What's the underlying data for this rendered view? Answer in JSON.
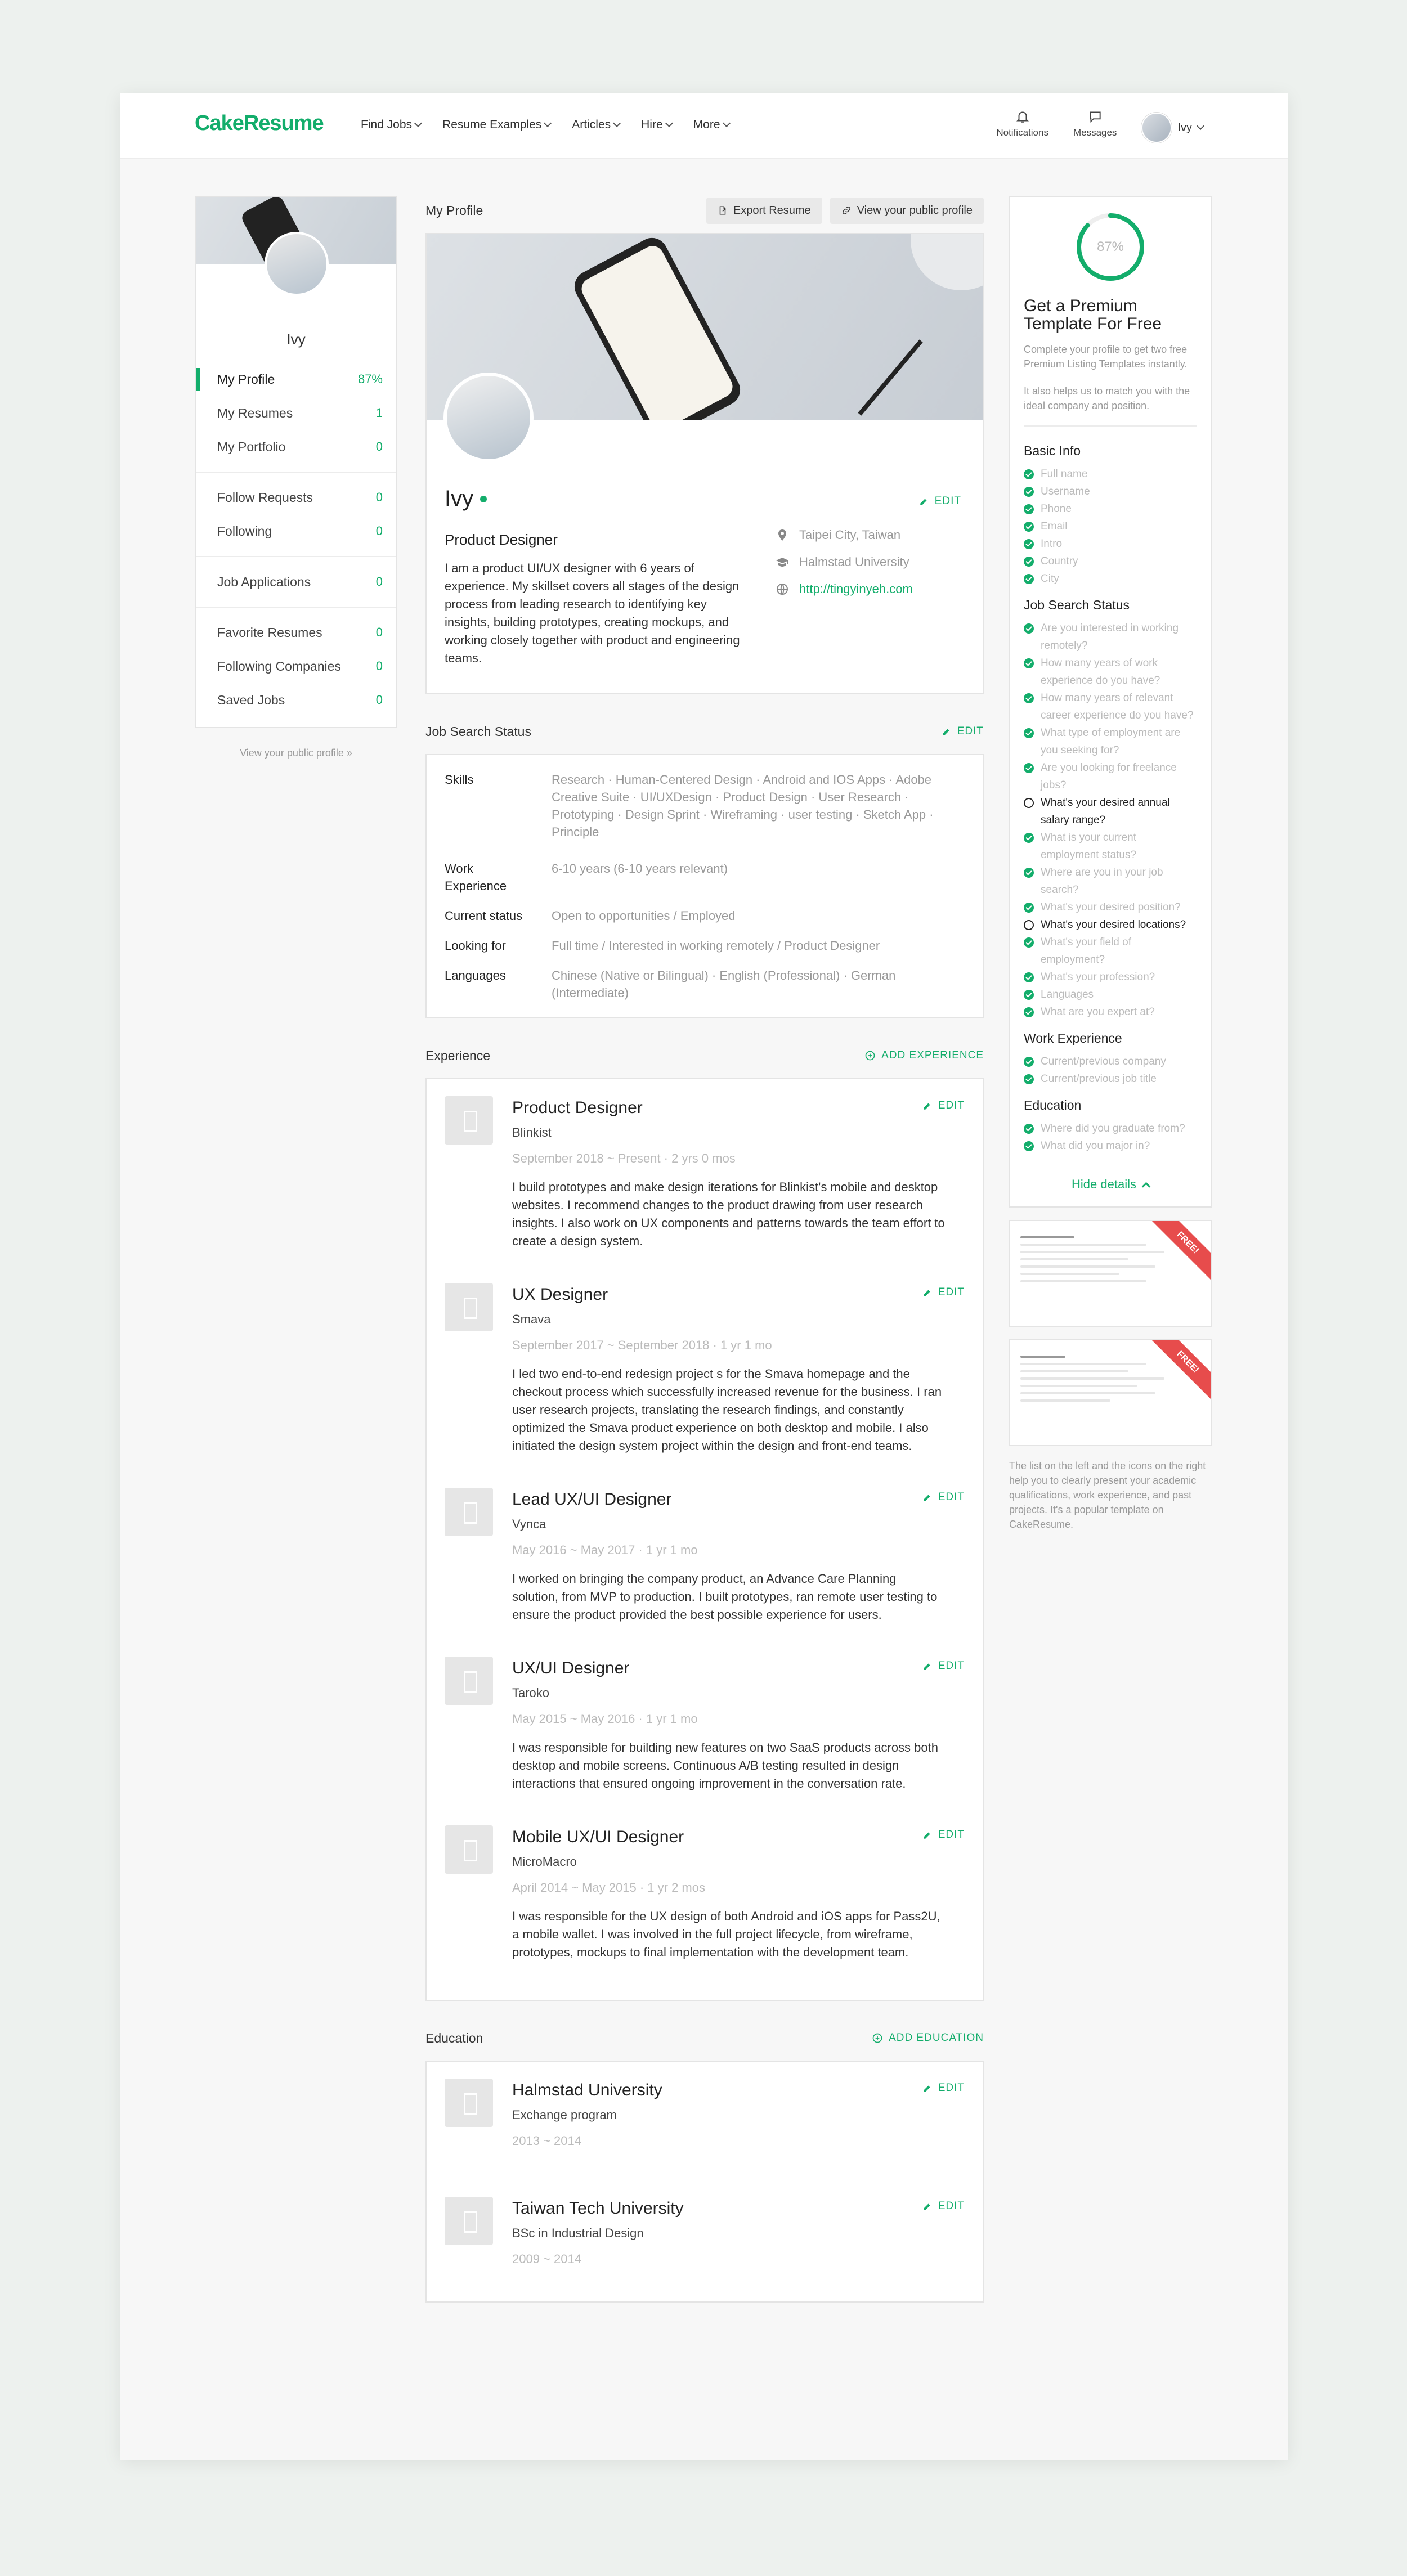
{
  "nav": {
    "logo": "CakeResume",
    "menu": [
      "Find Jobs",
      "Resume Examples",
      "Articles",
      "Hire",
      "More"
    ],
    "notifications": "Notifications",
    "messages": "Messages",
    "user": "Ivy"
  },
  "sidebar": {
    "name": "Ivy",
    "groups": [
      [
        {
          "label": "My Profile",
          "value": "87%"
        },
        {
          "label": "My Resumes",
          "value": "1"
        },
        {
          "label": "My Portfolio",
          "value": "0"
        }
      ],
      [
        {
          "label": "Follow Requests",
          "value": "0"
        },
        {
          "label": "Following",
          "value": "0"
        }
      ],
      [
        {
          "label": "Job Applications",
          "value": "0"
        }
      ],
      [
        {
          "label": "Favorite Resumes",
          "value": "0"
        },
        {
          "label": "Following Companies",
          "value": "0"
        },
        {
          "label": "Saved Jobs",
          "value": "0"
        }
      ]
    ],
    "footer_link": "View your public profile »"
  },
  "profile": {
    "section_title": "My Profile",
    "export_label": "Export Resume",
    "view_label": "View your public profile",
    "name": "Ivy",
    "edit_label": "EDIT",
    "role": "Product Designer",
    "bio": "I am a product UI/UX designer with 6 years of experience. My skillset covers all stages of the design process from leading research to identifying key insights, building prototypes, creating mockups, and working closely together with product and engineering teams.",
    "location": "Taipei City, Taiwan",
    "school": "Halmstad University",
    "website": "http://tingyinyeh.com"
  },
  "job_search": {
    "title": "Job Search Status",
    "rows": [
      {
        "label": "Skills",
        "value": "Research · Human-Centered Design · Android and IOS Apps · Adobe Creative Suite · UI/UXDesign · Product Design · User Research · Prototyping · Design Sprint · Wireframing · user testing · Sketch App · Principle"
      },
      {
        "label": "Work Experience",
        "value": "6-10 years (6-10 years relevant)"
      },
      {
        "label": "Current status",
        "value": "Open to opportunities / Employed"
      },
      {
        "label": "Looking for",
        "value": "Full time / Interested in working remotely / Product Designer"
      },
      {
        "label": "Languages",
        "value": "Chinese (Native or Bilingual) · English (Professional) · German (Intermediate)"
      }
    ]
  },
  "experience": {
    "title": "Experience",
    "add_label": "ADD EXPERIENCE",
    "items": [
      {
        "title": "Product Designer",
        "company": "Blinkist",
        "date": "September 2018 ~ Present · 2 yrs 0 mos",
        "desc": "I build prototypes and make design iterations for Blinkist's mobile and desktop websites. I recommend changes to the product drawing from user research insights. I also work on UX components and patterns towards the team effort to create a design system."
      },
      {
        "title": "UX Designer",
        "company": "Smava",
        "date": "September 2017 ~ September 2018 · 1 yr 1 mo",
        "desc": "I led two end-to-end redesign project s for the Smava homepage and the checkout process which successfully increased revenue for the business. I ran user research projects, translating the research findings, and constantly optimized the Smava product experience on both desktop and mobile. I also initiated the design system project within the design and front-end teams."
      },
      {
        "title": "Lead UX/UI Designer",
        "company": "Vynca",
        "date": "May 2016 ~ May 2017 · 1 yr 1 mo",
        "desc": "I worked on bringing the company product, an Advance Care Planning solution, from MVP to production. I built prototypes, ran remote user testing to ensure the product provided the best possible experience for users."
      },
      {
        "title": "UX/UI Designer",
        "company": "Taroko",
        "date": "May 2015 ~ May 2016 · 1 yr 1 mo",
        "desc": "I was responsible for building new features on two SaaS products across both desktop and mobile screens. Continuous A/B testing resulted in design interactions that ensured ongoing improvement in the conversation rate."
      },
      {
        "title": "Mobile UX/UI Designer",
        "company": "MicroMacro",
        "date": "April 2014 ~ May 2015 · 1 yr 2 mos",
        "desc": "I was responsible for the UX design of both Android and iOS apps for Pass2U, a mobile wallet. I was involved in the full project lifecycle, from wireframe, prototypes, mockups to final implementation with the development team."
      }
    ]
  },
  "education": {
    "title": "Education",
    "add_label": "ADD EDUCATION",
    "items": [
      {
        "school": "Halmstad University",
        "program": "Exchange program",
        "date": "2013 ~ 2014"
      },
      {
        "school": "Taiwan Tech University",
        "program": "BSc in Industrial Design",
        "date": "2009 ~ 2014"
      }
    ]
  },
  "right": {
    "percent": "87%",
    "percent_value": 0.87,
    "heading": "Get a Premium Template For Free",
    "text1": "Complete your profile to get two free Premium Listing Templates instantly.",
    "text2": "It also helps us to match you with the ideal company and position.",
    "sections": [
      {
        "title": "Basic Info",
        "items": [
          {
            "t": "Full name",
            "done": true
          },
          {
            "t": "Username",
            "done": true
          },
          {
            "t": "Phone",
            "done": true
          },
          {
            "t": "Email",
            "done": true
          },
          {
            "t": "Intro",
            "done": true
          },
          {
            "t": "Country",
            "done": true
          },
          {
            "t": "City",
            "done": true
          }
        ]
      },
      {
        "title": "Job Search Status",
        "items": [
          {
            "t": "Are you interested in working remotely?",
            "done": true
          },
          {
            "t": "How many years of work experience do you have?",
            "done": true
          },
          {
            "t": "How many years of relevant career experience do you have?",
            "done": true
          },
          {
            "t": "What type of employment are you seeking for?",
            "done": true
          },
          {
            "t": "Are you looking for freelance jobs?",
            "done": true
          },
          {
            "t": "What's your desired annual salary range?",
            "done": false
          },
          {
            "t": "What is your current employment status?",
            "done": true
          },
          {
            "t": "Where are you in your job search?",
            "done": true
          },
          {
            "t": "What's your desired position?",
            "done": true
          },
          {
            "t": "What's your desired locations?",
            "done": false
          },
          {
            "t": "What's your field of employment?",
            "done": true
          },
          {
            "t": "What's your profession?",
            "done": true
          },
          {
            "t": "Languages",
            "done": true
          },
          {
            "t": "What are you expert at?",
            "done": true
          }
        ]
      },
      {
        "title": "Work Experience",
        "items": [
          {
            "t": "Current/previous company",
            "done": true
          },
          {
            "t": "Current/previous job title",
            "done": true
          }
        ]
      },
      {
        "title": "Education",
        "items": [
          {
            "t": "Where did you graduate from?",
            "done": true
          },
          {
            "t": "What did you major in?",
            "done": true
          }
        ]
      }
    ],
    "hide_label": "Hide details",
    "ribbon": "FREE!",
    "template_caption": "The list on the left and the icons on the right help you to clearly present your academic qualifications, work experience, and past projects. It's a popular template on CakeResume.",
    "accent": "#13ad6b"
  }
}
